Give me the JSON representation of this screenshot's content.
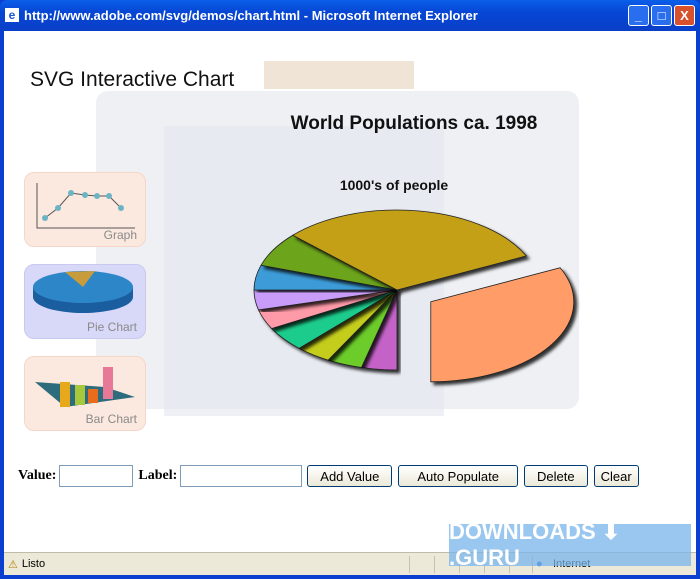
{
  "window": {
    "title": "http://www.adobe.com/svg/demos/chart.html - Microsoft Internet Explorer",
    "minimize": "_",
    "maximize": "□",
    "close": "X"
  },
  "page": {
    "title": "SVG Interactive Chart",
    "thumbnails": [
      {
        "label": "Graph"
      },
      {
        "label": "Pie Chart"
      },
      {
        "label": "Bar Chart"
      }
    ]
  },
  "chart_data": {
    "type": "pie",
    "title": "World Populations ca. 1998",
    "subtitle": "1000's of people",
    "style": "3d-exploded",
    "values": [
      4,
      4,
      4,
      5,
      4,
      4,
      5,
      7,
      31,
      32
    ],
    "colors": [
      "#c462c8",
      "#6ccc2c",
      "#c4cc1c",
      "#1ccc8c",
      "#ff9aa8",
      "#c89cf8",
      "#3c9cd8",
      "#6ca41c",
      "#c4a018",
      "#ff9c68"
    ],
    "exploded_index": 9
  },
  "form": {
    "value_label": "Value:",
    "value": "",
    "label_label": "Label:",
    "label": "",
    "add": "Add Value",
    "auto": "Auto Populate",
    "delete": "Delete",
    "clear": "Clear"
  },
  "status": {
    "text": "Listo",
    "zone": "Internet"
  },
  "watermark": "DOWNLOADS ⬇ .GURU"
}
